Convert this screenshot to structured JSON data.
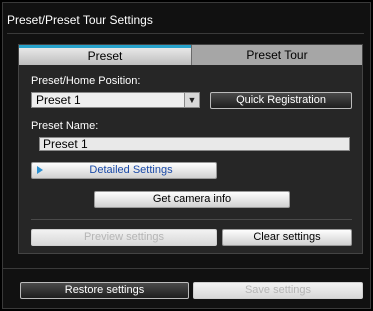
{
  "window": {
    "title": "Preset/Preset Tour Settings"
  },
  "tabs": [
    {
      "label": "Preset",
      "active": true
    },
    {
      "label": "Preset Tour",
      "active": false
    }
  ],
  "preset_home": {
    "label": "Preset/Home Position:",
    "selected": "Preset 1",
    "quick_registration": "Quick Registration"
  },
  "preset_name": {
    "label": "Preset Name:",
    "value": "Preset 1"
  },
  "buttons": {
    "detailed_settings": "Detailed Settings",
    "get_camera_info": "Get camera info",
    "preview_settings": "Preview settings",
    "clear_settings": "Clear settings",
    "restore_settings": "Restore settings",
    "save_settings": "Save settings"
  },
  "colors": {
    "accent_tab": "#27a3cc",
    "link_text": "#1a4aa8",
    "background": "#111111"
  }
}
